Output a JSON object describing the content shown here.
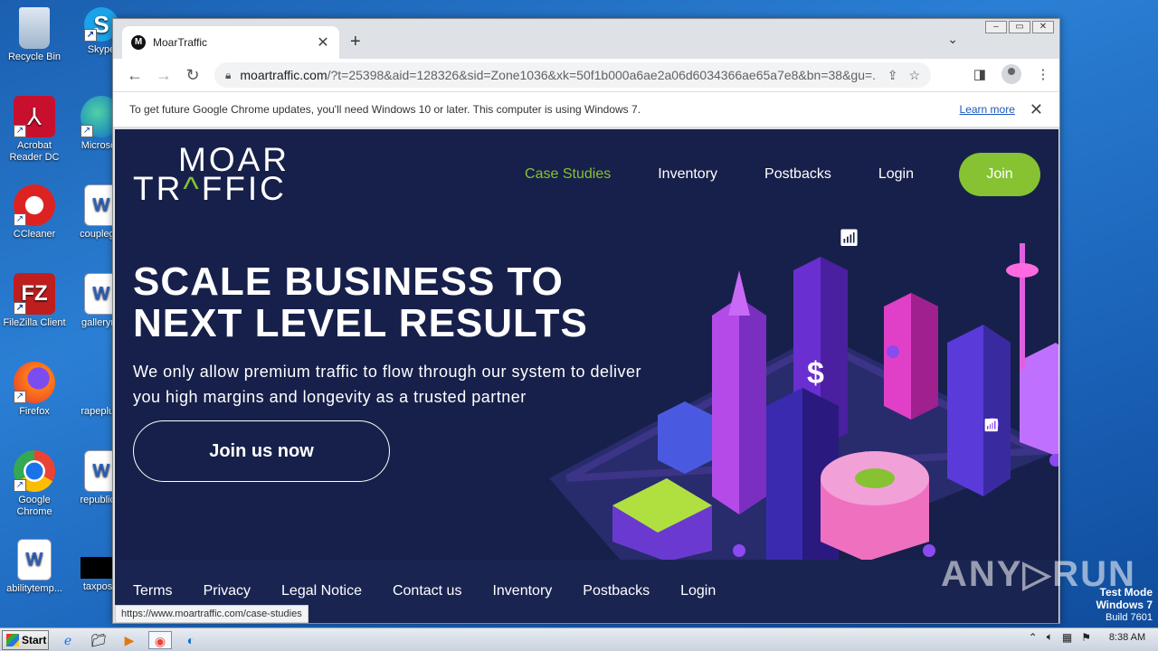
{
  "desktop": {
    "icons": [
      {
        "label": "Recycle Bin"
      },
      {
        "label": "Skype"
      },
      {
        "label": "Acrobat Reader DC"
      },
      {
        "label": "Microsoft"
      },
      {
        "label": "CCleaner"
      },
      {
        "label": "couplegm"
      },
      {
        "label": "FileZilla Client"
      },
      {
        "label": "gallerymi"
      },
      {
        "label": "Firefox"
      },
      {
        "label": "rapeplus."
      },
      {
        "label": "Google Chrome"
      },
      {
        "label": "republicin"
      },
      {
        "label": "abilitytemp..."
      },
      {
        "label": "taxpositi"
      }
    ]
  },
  "browser": {
    "tab_title": "MoarTraffic",
    "tab_favicon_letter": "M",
    "url_host": "moartraffic.com",
    "url_rest": "/?t=25398&aid=128326&sid=Zone1036&xk=50f1b000a6ae2a06d6034366ae65a7e8&bn=38&gu=...",
    "infobar_message": "To get future Google Chrome updates, you'll need Windows 10 or later. This computer is using Windows 7.",
    "infobar_link": "Learn more",
    "status_url": "https://www.moartraffic.com/case-studies"
  },
  "site": {
    "logo_line1": "MOAR",
    "logo_line2_a": "TR",
    "logo_line2_hat": "^",
    "logo_line2_b": "FFIC",
    "nav": {
      "case_studies": "Case Studies",
      "inventory": "Inventory",
      "postbacks": "Postbacks",
      "login": "Login",
      "join": "Join"
    },
    "hero_line1": "SCALE BUSINESS TO",
    "hero_line2": "NEXT LEVEL RESULTS",
    "hero_sub_line1": "We only allow premium traffic to flow through our system to deliver",
    "hero_sub_line2": "you high margins and longevity as a trusted partner",
    "cta": "Join us now",
    "footer": {
      "terms": "Terms",
      "privacy": "Privacy",
      "legal": "Legal Notice",
      "contact": "Contact us",
      "inventory": "Inventory",
      "postbacks": "Postbacks",
      "login": "Login"
    },
    "accent_color": "#86c232",
    "background_color": "#17204a"
  },
  "watermark": {
    "brand": "ANY▷RUN",
    "line1": "Test Mode",
    "line2": "Windows 7",
    "line3": "Build 7601"
  },
  "taskbar": {
    "start": "Start",
    "clock": "8:38 AM"
  }
}
